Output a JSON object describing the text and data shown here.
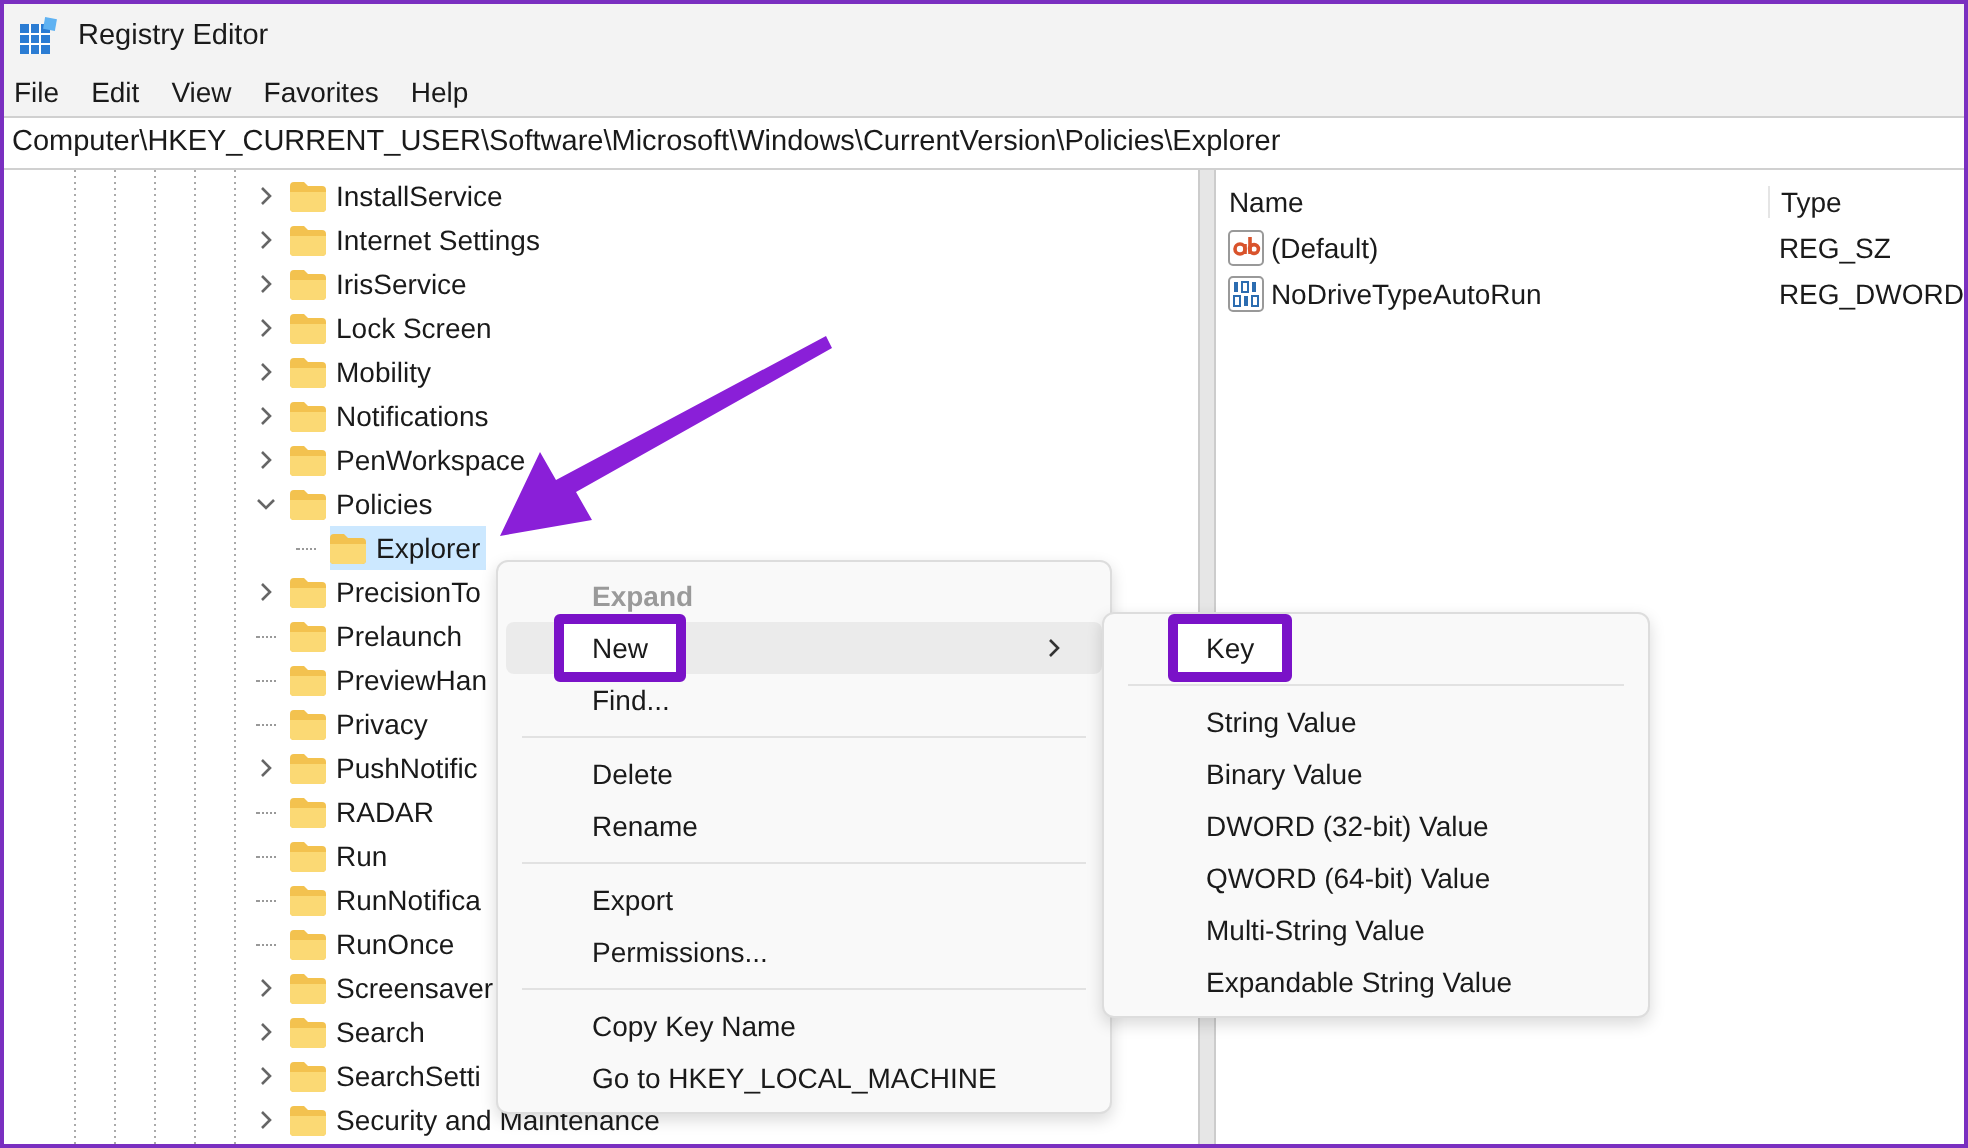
{
  "window": {
    "title": "Registry Editor"
  },
  "menu_bar": [
    {
      "label": "File"
    },
    {
      "label": "Edit"
    },
    {
      "label": "View"
    },
    {
      "label": "Favorites"
    },
    {
      "label": "Help"
    }
  ],
  "address_bar": {
    "value": "Computer\\HKEY_CURRENT_USER\\Software\\Microsoft\\Windows\\CurrentVersion\\Policies\\Explorer"
  },
  "tree": {
    "items": [
      {
        "label": "InstallService",
        "expandable": true,
        "expanded": false,
        "selected": false
      },
      {
        "label": "Internet Settings",
        "expandable": true,
        "expanded": false,
        "selected": false
      },
      {
        "label": "IrisService",
        "expandable": true,
        "expanded": false,
        "selected": false
      },
      {
        "label": "Lock Screen",
        "expandable": true,
        "expanded": false,
        "selected": false
      },
      {
        "label": "Mobility",
        "expandable": true,
        "expanded": false,
        "selected": false
      },
      {
        "label": "Notifications",
        "expandable": true,
        "expanded": false,
        "selected": false
      },
      {
        "label": "PenWorkspace",
        "expandable": true,
        "expanded": false,
        "selected": false
      },
      {
        "label": "Policies",
        "expandable": true,
        "expanded": true,
        "selected": false,
        "children": [
          {
            "label": "Explorer",
            "expandable": false,
            "selected": true
          }
        ]
      },
      {
        "label": "PrecisionTo",
        "expandable": true,
        "expanded": false,
        "selected": false
      },
      {
        "label": "Prelaunch",
        "expandable": false,
        "selected": false
      },
      {
        "label": "PreviewHan",
        "expandable": false,
        "selected": false
      },
      {
        "label": "Privacy",
        "expandable": false,
        "selected": false
      },
      {
        "label": "PushNotific",
        "expandable": true,
        "expanded": false,
        "selected": false
      },
      {
        "label": "RADAR",
        "expandable": false,
        "selected": false
      },
      {
        "label": "Run",
        "expandable": false,
        "selected": false
      },
      {
        "label": "RunNotifica",
        "expandable": false,
        "selected": false
      },
      {
        "label": "RunOnce",
        "expandable": false,
        "selected": false
      },
      {
        "label": "Screensaver",
        "expandable": true,
        "expanded": false,
        "selected": false
      },
      {
        "label": "Search",
        "expandable": true,
        "expanded": false,
        "selected": false
      },
      {
        "label": "SearchSetti",
        "expandable": true,
        "expanded": false,
        "selected": false
      },
      {
        "label": "Security and Maintenance",
        "expandable": true,
        "expanded": false,
        "selected": false
      }
    ]
  },
  "values_table": {
    "columns": [
      "Name",
      "Type"
    ],
    "rows": [
      {
        "kind": "string",
        "name": "(Default)",
        "type": "REG_SZ"
      },
      {
        "kind": "binary",
        "name": "NoDriveTypeAutoRun",
        "type": "REG_DWORD"
      }
    ]
  },
  "context_menu": {
    "items": [
      {
        "kind": "item",
        "label": "Expand",
        "disabled": true,
        "hovered": false,
        "submenu": false,
        "highlighted": false
      },
      {
        "kind": "item",
        "label": "New",
        "disabled": false,
        "hovered": true,
        "submenu": true,
        "highlighted": true
      },
      {
        "kind": "item",
        "label": "Find...",
        "disabled": false,
        "hovered": false,
        "submenu": false,
        "highlighted": false
      },
      {
        "kind": "separator"
      },
      {
        "kind": "item",
        "label": "Delete",
        "disabled": false,
        "hovered": false,
        "submenu": false,
        "highlighted": false
      },
      {
        "kind": "item",
        "label": "Rename",
        "disabled": false,
        "hovered": false,
        "submenu": false,
        "highlighted": false
      },
      {
        "kind": "separator"
      },
      {
        "kind": "item",
        "label": "Export",
        "disabled": false,
        "hovered": false,
        "submenu": false,
        "highlighted": false
      },
      {
        "kind": "item",
        "label": "Permissions...",
        "disabled": false,
        "hovered": false,
        "submenu": false,
        "highlighted": false
      },
      {
        "kind": "separator"
      },
      {
        "kind": "item",
        "label": "Copy Key Name",
        "disabled": false,
        "hovered": false,
        "submenu": false,
        "highlighted": false
      },
      {
        "kind": "item",
        "label": "Go to HKEY_LOCAL_MACHINE",
        "disabled": false,
        "hovered": false,
        "submenu": false,
        "highlighted": false
      }
    ]
  },
  "submenu": {
    "items": [
      {
        "kind": "item",
        "label": "Key",
        "highlighted": true
      },
      {
        "kind": "separator"
      },
      {
        "kind": "item",
        "label": "String Value",
        "highlighted": false
      },
      {
        "kind": "item",
        "label": "Binary Value",
        "highlighted": false
      },
      {
        "kind": "item",
        "label": "DWORD (32-bit) Value",
        "highlighted": false
      },
      {
        "kind": "item",
        "label": "QWORD (64-bit) Value",
        "highlighted": false
      },
      {
        "kind": "item",
        "label": "Multi-String Value",
        "highlighted": false
      },
      {
        "kind": "item",
        "label": "Expandable String Value",
        "highlighted": false
      }
    ]
  }
}
